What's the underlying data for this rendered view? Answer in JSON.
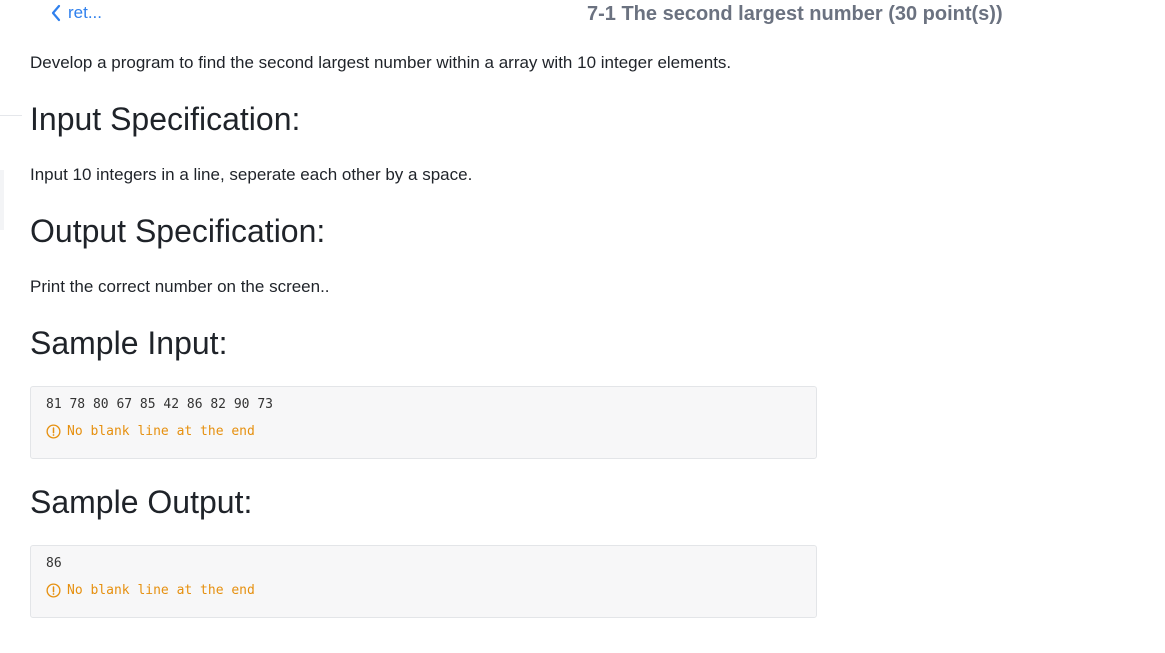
{
  "header": {
    "back_label": "ret...",
    "title": "7-1 The second largest number (30 point(s))"
  },
  "problem": {
    "description": "Develop a program to find the second largest number within a array with 10 integer elements.",
    "input_spec_heading": "Input Specification:",
    "input_spec_text": "Input 10 integers in a line, seperate each other by a space.",
    "output_spec_heading": "Output Specification:",
    "output_spec_text": "Print the correct number on the screen..",
    "sample_input_heading": "Sample Input:",
    "sample_input_code": "81 78 80 67 85 42 86 82 90 73",
    "sample_input_note": "No blank line at the end",
    "sample_output_heading": "Sample Output:",
    "sample_output_code": "86",
    "sample_output_note": "No blank line at the end"
  },
  "colors": {
    "link": "#2f80ed",
    "warning": "#e6900f",
    "title_gray": "#6b7280"
  },
  "icons": {
    "back": "chevron-left-icon",
    "note": "warning-circle-icon"
  }
}
